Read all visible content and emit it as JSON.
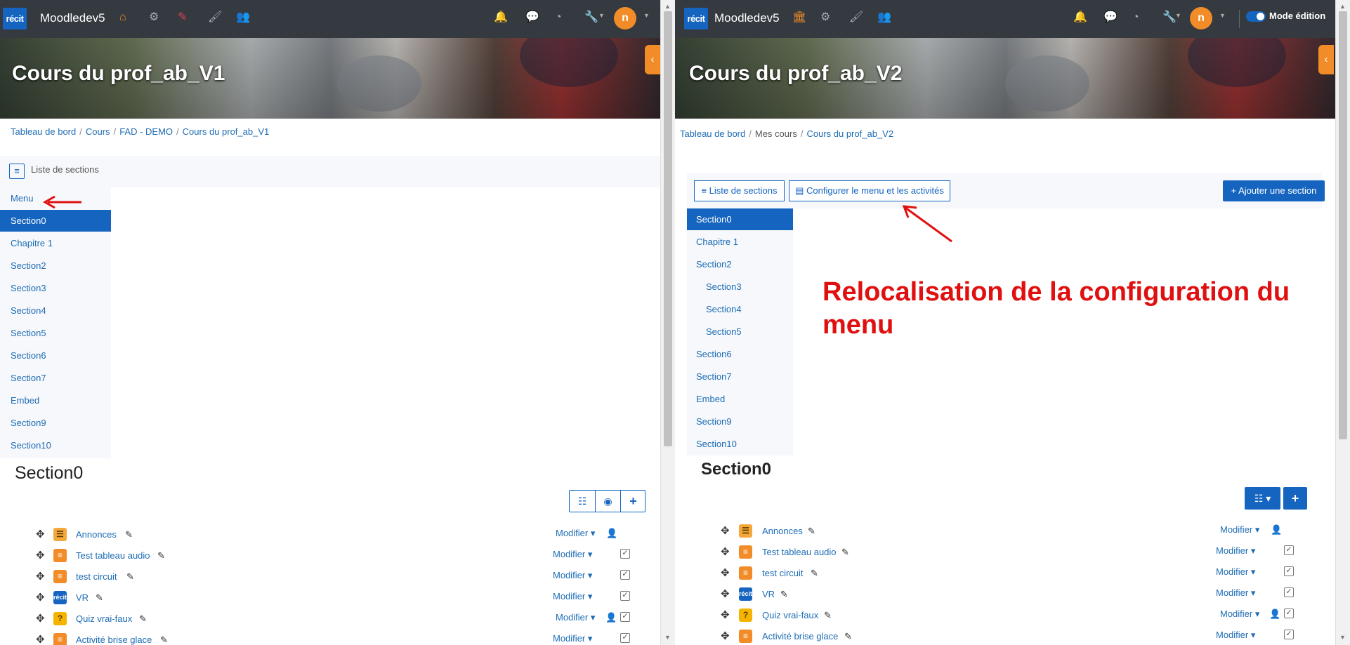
{
  "left": {
    "site_name": "Moodledev5",
    "logo_text": "récit",
    "avatar_text": "n",
    "course_title": "Cours du prof_ab_V1",
    "breadcrumb": [
      "Tableau de bord",
      "Cours",
      "FAD - DEMO",
      "Cours du prof_ab_V1"
    ],
    "section_list_label": "Liste de sections",
    "menu_label": "Menu",
    "sections": [
      "Section0",
      "Chapitre 1",
      "Section2",
      "Section3",
      "Section4",
      "Section5",
      "Section6",
      "Section7",
      "Embed",
      "Section9",
      "Section10"
    ],
    "active_section": "Section0",
    "section_heading": "Section0",
    "activities": [
      {
        "name": "Annonces",
        "icon": "forum-icon",
        "modify": "Modifier"
      },
      {
        "name": "Test tableau audio",
        "icon": "page-icon",
        "modify": "Modifier"
      },
      {
        "name": "test circuit",
        "icon": "page-icon",
        "modify": "Modifier"
      },
      {
        "name": "VR",
        "icon": "recit-icon",
        "modify": "Modifier"
      },
      {
        "name": "Quiz vrai-faux",
        "icon": "quiz-icon",
        "modify": "Modifier"
      },
      {
        "name": "Activité brise glace",
        "icon": "page-icon",
        "modify": "Modifier"
      }
    ]
  },
  "right": {
    "site_name": "Moodledev5",
    "logo_text": "récit",
    "avatar_text": "n",
    "edit_mode_label": "Mode édition",
    "course_title": "Cours du prof_ab_V2",
    "breadcrumb": [
      "Tableau de bord",
      "Mes cours",
      "Cours du prof_ab_V2"
    ],
    "section_list_button": "Liste de sections",
    "configure_button": "Configurer le menu et les activités",
    "add_section_button": "Ajouter une section",
    "sections": [
      "Section0",
      "Chapitre 1",
      "Section2",
      "Section3",
      "Section4",
      "Section5",
      "Section6",
      "Section7",
      "Embed",
      "Section9",
      "Section10"
    ],
    "active_section": "Section0",
    "section_heading": "Section0",
    "annotation": "Relocalisation de la configuration du menu",
    "activities": [
      {
        "name": "Annonces",
        "icon": "forum-icon",
        "modify": "Modifier"
      },
      {
        "name": "Test tableau audio",
        "icon": "page-icon",
        "modify": "Modifier"
      },
      {
        "name": "test circuit",
        "icon": "page-icon",
        "modify": "Modifier"
      },
      {
        "name": "VR",
        "icon": "recit-icon",
        "modify": "Modifier"
      },
      {
        "name": "Quiz vrai-faux",
        "icon": "quiz-icon",
        "modify": "Modifier"
      },
      {
        "name": "Activité brise glace",
        "icon": "page-icon",
        "modify": "Modifier"
      }
    ]
  },
  "colors": {
    "navbar": "#343a40",
    "primary": "#1565c0",
    "accent": "#f28c28",
    "annotation": "#e01010"
  }
}
